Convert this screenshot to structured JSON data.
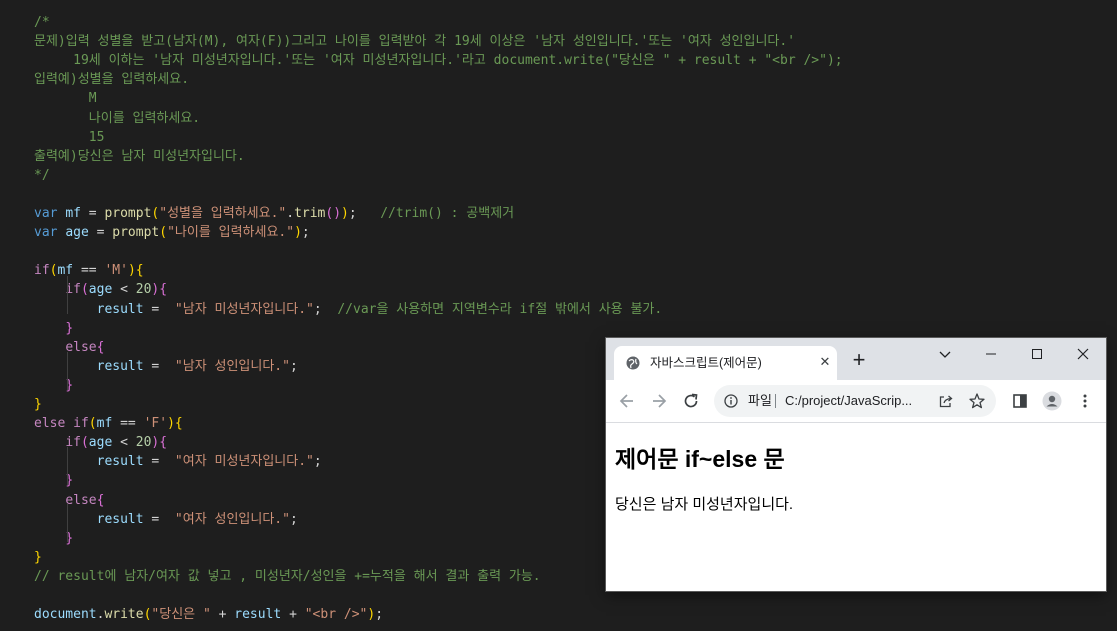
{
  "editor": {
    "lines": [
      [
        [
          "cm",
          "/*"
        ]
      ],
      [
        [
          "cm",
          "문제)입력 성별을 받고(남자(M), 여자(F))그리고 나이를 입력받아 각 19세 이상은 '남자 성인입니다.'또는 '여자 성인입니다.'"
        ]
      ],
      [
        [
          "cm",
          "     19세 이하는 '남자 미성년자입니다.'또는 '여자 미성년자입니다.'라고 document.write(\"당신은 \" + result + \"<br />\");"
        ]
      ],
      [
        [
          "cm",
          "입력예)성별을 입력하세요."
        ]
      ],
      [
        [
          "cm",
          "       M"
        ]
      ],
      [
        [
          "cm",
          "       나이를 입력하세요."
        ]
      ],
      [
        [
          "cm",
          "       15"
        ]
      ],
      [
        [
          "cm",
          "출력예)당신은 남자 미성년자입니다."
        ]
      ],
      [
        [
          "cm",
          "*/"
        ]
      ],
      [],
      [
        [
          "kw",
          "var "
        ],
        [
          "vr",
          "mf"
        ],
        [
          "op",
          " = "
        ],
        [
          "fn",
          "prompt"
        ],
        [
          "br",
          "("
        ],
        [
          "st",
          "\"성별을 입력하세요.\""
        ],
        [
          "op",
          "."
        ],
        [
          "fn",
          "trim"
        ],
        [
          "br2",
          "()"
        ],
        [
          "br",
          ")"
        ],
        [
          "op",
          ";   "
        ],
        [
          "cm",
          "//trim() : 공백제거"
        ]
      ],
      [
        [
          "kw",
          "var "
        ],
        [
          "vr",
          "age"
        ],
        [
          "op",
          " = "
        ],
        [
          "fn",
          "prompt"
        ],
        [
          "br",
          "("
        ],
        [
          "st",
          "\"나이를 입력하세요.\""
        ],
        [
          "br",
          ")"
        ],
        [
          "op",
          ";"
        ]
      ],
      [],
      [
        [
          "cf",
          "if"
        ],
        [
          "br",
          "("
        ],
        [
          "vr",
          "mf"
        ],
        [
          "op",
          " == "
        ],
        [
          "st",
          "'M'"
        ],
        [
          "br",
          ")"
        ],
        [
          "br",
          "{"
        ]
      ],
      [
        [
          "op",
          "    "
        ],
        [
          "cf",
          "if"
        ],
        [
          "br2",
          "("
        ],
        [
          "vr",
          "age"
        ],
        [
          "op",
          " < "
        ],
        [
          "nm",
          "20"
        ],
        [
          "br2",
          ")"
        ],
        [
          "br2",
          "{"
        ]
      ],
      [
        [
          "op",
          "        "
        ],
        [
          "vr",
          "result"
        ],
        [
          "op",
          " =  "
        ],
        [
          "st",
          "\"남자 미성년자입니다.\""
        ],
        [
          "op",
          ";  "
        ],
        [
          "cm",
          "//var을 사용하면 지역변수라 if절 밖에서 사용 불가."
        ]
      ],
      [
        [
          "op",
          "    "
        ],
        [
          "br2",
          "}"
        ]
      ],
      [
        [
          "op",
          "    "
        ],
        [
          "cf",
          "else"
        ],
        [
          "br2",
          "{"
        ]
      ],
      [
        [
          "op",
          "        "
        ],
        [
          "vr",
          "result"
        ],
        [
          "op",
          " =  "
        ],
        [
          "st",
          "\"남자 성인입니다.\""
        ],
        [
          "op",
          ";"
        ]
      ],
      [
        [
          "op",
          "    "
        ],
        [
          "br2",
          "}"
        ]
      ],
      [
        [
          "br",
          "}"
        ]
      ],
      [
        [
          "cf",
          "else if"
        ],
        [
          "br",
          "("
        ],
        [
          "vr",
          "mf"
        ],
        [
          "op",
          " == "
        ],
        [
          "st",
          "'F'"
        ],
        [
          "br",
          ")"
        ],
        [
          "br",
          "{"
        ]
      ],
      [
        [
          "op",
          "    "
        ],
        [
          "cf",
          "if"
        ],
        [
          "br2",
          "("
        ],
        [
          "vr",
          "age"
        ],
        [
          "op",
          " < "
        ],
        [
          "nm",
          "20"
        ],
        [
          "br2",
          ")"
        ],
        [
          "br2",
          "{"
        ]
      ],
      [
        [
          "op",
          "        "
        ],
        [
          "vr",
          "result"
        ],
        [
          "op",
          " =  "
        ],
        [
          "st",
          "\"여자 미성년자입니다.\""
        ],
        [
          "op",
          ";"
        ]
      ],
      [
        [
          "op",
          "    "
        ],
        [
          "br2",
          "}"
        ]
      ],
      [
        [
          "op",
          "    "
        ],
        [
          "cf",
          "else"
        ],
        [
          "br2",
          "{"
        ]
      ],
      [
        [
          "op",
          "        "
        ],
        [
          "vr",
          "result"
        ],
        [
          "op",
          " =  "
        ],
        [
          "st",
          "\"여자 성인입니다.\""
        ],
        [
          "op",
          ";"
        ]
      ],
      [
        [
          "op",
          "    "
        ],
        [
          "br2",
          "}"
        ]
      ],
      [
        [
          "br",
          "}"
        ]
      ],
      [
        [
          "cm",
          "// result에 남자/여자 값 넣고 , 미성년자/성인을 +=누적을 해서 결과 출력 가능."
        ]
      ],
      [],
      [
        [
          "vr",
          "document"
        ],
        [
          "op",
          "."
        ],
        [
          "fn",
          "write"
        ],
        [
          "br",
          "("
        ],
        [
          "st",
          "\"당신은 \""
        ],
        [
          "op",
          " + "
        ],
        [
          "vr",
          "result"
        ],
        [
          "op",
          " + "
        ],
        [
          "st",
          "\"<br />\""
        ],
        [
          "br",
          ")"
        ],
        [
          "op",
          ";"
        ]
      ]
    ]
  },
  "browser": {
    "tab_title": "자바스크립트(제어문)",
    "tab_close_glyph": "✕",
    "new_tab_glyph": "+",
    "address_scheme": "파일",
    "address_url": "C:/project/JavaScrip...",
    "page": {
      "heading": "제어문 if~else 문",
      "text": "당신은 남자 미성년자입니다."
    },
    "icons": {
      "tab_favicon": "globe-icon",
      "tab_search": "chevron-down-icon",
      "minimize": "minimize-icon",
      "maximize": "maximize-icon",
      "close": "close-icon",
      "back": "back-arrow-icon",
      "forward": "forward-arrow-icon",
      "reload": "reload-icon",
      "site_info": "info-icon",
      "share": "share-icon",
      "bookmark": "star-icon",
      "side_panel": "side-panel-icon",
      "profile": "profile-icon",
      "menu": "more-vert-icon"
    }
  }
}
